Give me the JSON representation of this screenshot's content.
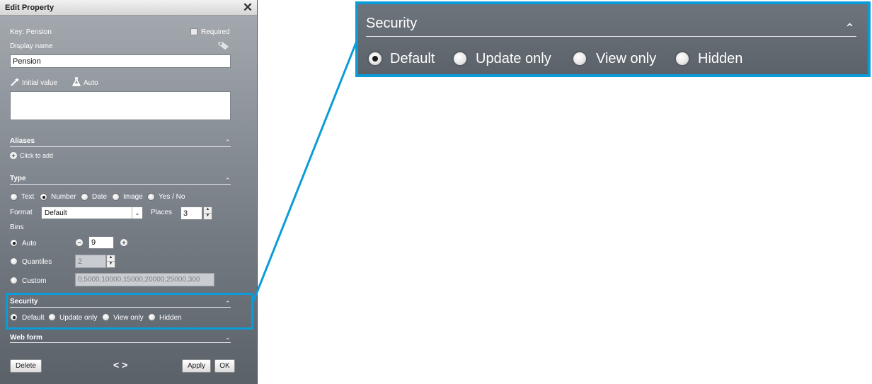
{
  "dialog": {
    "title": "Edit Property",
    "key_label": "Key: Pension",
    "required_label": "Required",
    "display_name_label": "Display name",
    "display_name_value": "Pension",
    "initial_value_label": "Initial value",
    "auto_label": "Auto",
    "initial_value_text": ""
  },
  "aliases": {
    "header": "Aliases",
    "add_label": "Click to add"
  },
  "type": {
    "header": "Type",
    "options": [
      "Text",
      "Number",
      "Date",
      "Image",
      "Yes / No"
    ],
    "selected": "Number",
    "format_label": "Format",
    "format_value": "Default",
    "places_label": "Places",
    "places_value": "3"
  },
  "bins": {
    "label": "Bins",
    "auto_label": "Auto",
    "auto_value": "9",
    "quantiles_label": "Quantiles",
    "quantiles_value": "2",
    "custom_label": "Custom",
    "custom_value": "0,5000,10000,15000,20000,25000,300",
    "selected": "Auto"
  },
  "security": {
    "header": "Security",
    "options": [
      "Default",
      "Update only",
      "View only",
      "Hidden"
    ],
    "selected": "Default"
  },
  "web_form": {
    "header": "Web form"
  },
  "buttons": {
    "delete": "Delete",
    "apply": "Apply",
    "ok": "OK",
    "nav": "< >"
  },
  "colors": {
    "highlight": "#0a9cd8",
    "panel_top": "#a6abb1",
    "panel_bottom": "#5a6169"
  }
}
